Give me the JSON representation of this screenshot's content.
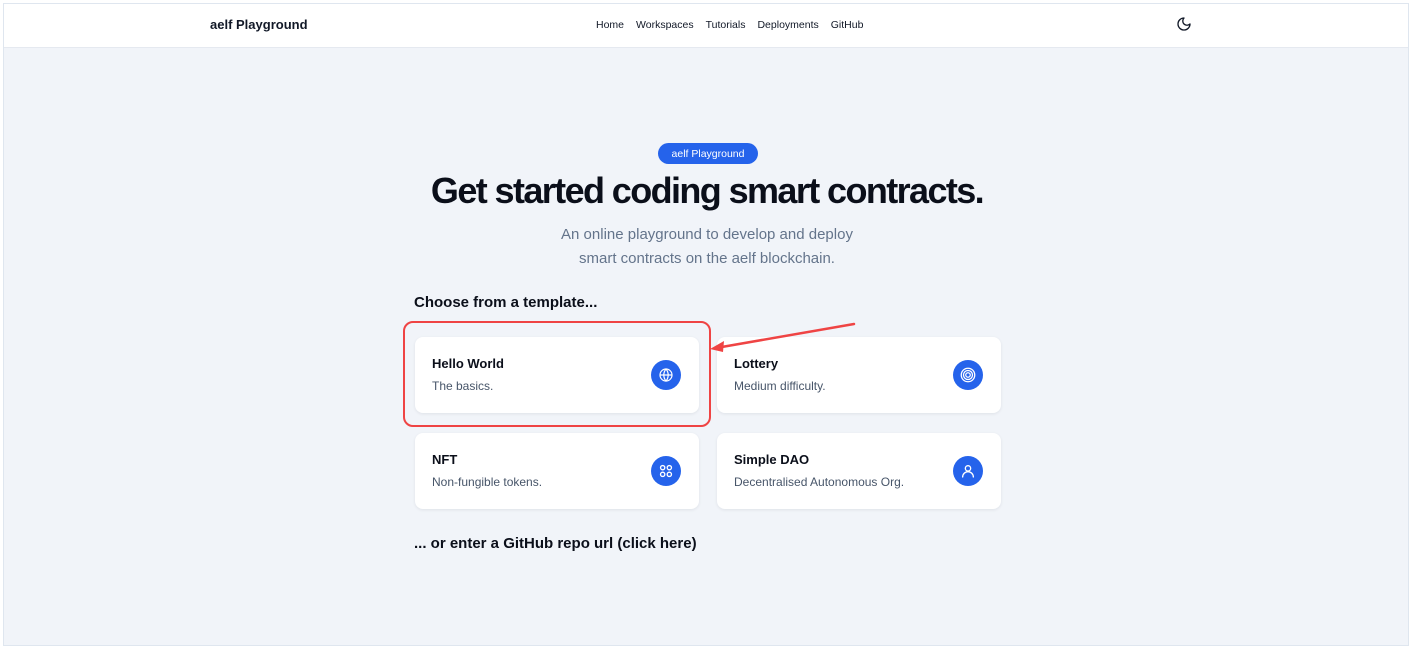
{
  "header": {
    "brand": "aelf Playground",
    "nav": [
      "Home",
      "Workspaces",
      "Tutorials",
      "Deployments",
      "GitHub"
    ],
    "theme_toggle_icon": "moon-icon"
  },
  "hero": {
    "badge": "aelf Playground",
    "title": "Get started coding smart contracts.",
    "subtitle_line1": "An online playground to develop and deploy",
    "subtitle_line2": "smart contracts on the aelf blockchain."
  },
  "templates": {
    "label": "Choose from a template...",
    "items": [
      {
        "title": "Hello World",
        "desc": "The basics.",
        "icon": "globe-icon"
      },
      {
        "title": "Lottery",
        "desc": "Medium difficulty.",
        "icon": "target-icon"
      },
      {
        "title": "NFT",
        "desc": "Non-fungible tokens.",
        "icon": "grid-circles-icon"
      },
      {
        "title": "Simple DAO",
        "desc": "Decentralised Autonomous Org.",
        "icon": "user-icon"
      }
    ]
  },
  "github": {
    "label": "... or enter a GitHub repo url (click here)"
  },
  "colors": {
    "accent": "#2563eb",
    "annotation": "#ef4444",
    "background": "#f1f4f9"
  }
}
